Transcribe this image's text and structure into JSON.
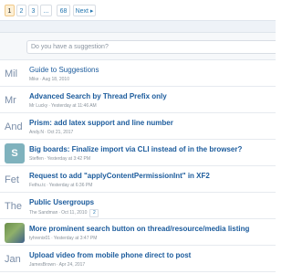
{
  "pagination": {
    "pages": [
      "1",
      "2",
      "3",
      "...",
      "68"
    ],
    "next_label": "Next ▸"
  },
  "suggestion": {
    "placeholder": "Do you have a suggestion?"
  },
  "threads": [
    {
      "avatar_text": "Mil",
      "avatar_type": "letters",
      "title": "Guide to Suggestions",
      "bold": false,
      "author": "Mike",
      "date": "Aug 18, 2010"
    },
    {
      "avatar_text": "Mr",
      "avatar_type": "letters",
      "title": "Advanced Search by Thread Prefix only",
      "bold": true,
      "author": "Mr Lucky",
      "date": "Yesterday at 11:46 AM"
    },
    {
      "avatar_text": "And",
      "avatar_type": "letters",
      "title": "Prism: add latex support and line number",
      "bold": true,
      "author": "Andy.N",
      "date": "Oct 21, 2017"
    },
    {
      "avatar_text": "S",
      "avatar_type": "box",
      "avatar_color": "#7fb2bd",
      "title": "Big boards: Finalize import via CLI instead of in the browser?",
      "bold": true,
      "author": "Steffen",
      "date": "Yesterday at 3:42 PM"
    },
    {
      "avatar_text": "Fet",
      "avatar_type": "letters",
      "title": "Request to add \"applyContentPermissionInt\" in XF2",
      "bold": true,
      "author": "Fethu.tc",
      "date": "Yesterday at 6:36 PM"
    },
    {
      "avatar_text": "The",
      "avatar_type": "letters",
      "title": "Public Usergroups",
      "bold": true,
      "author": "The Sandman",
      "date": "Oct 11, 2010",
      "mini_page": "2"
    },
    {
      "avatar_text": "",
      "avatar_type": "photo",
      "title": "More prominent search button on thread/resource/media listing",
      "bold": true,
      "author": "tyhrenix01",
      "date": "Yesterday at 3:47 PM"
    },
    {
      "avatar_text": "Jan",
      "avatar_type": "letters",
      "title": "Upload video from mobile phone direct to post",
      "bold": true,
      "author": "JamesBrown",
      "date": "Apr 24, 2017"
    }
  ]
}
